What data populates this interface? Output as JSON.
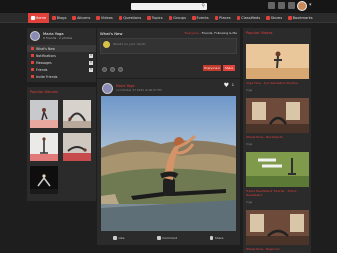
{
  "nav": {
    "items": [
      {
        "label": "Home",
        "active": true
      },
      {
        "label": "Blogs"
      },
      {
        "label": "Albums"
      },
      {
        "label": "Videos"
      },
      {
        "label": "Questions"
      },
      {
        "label": "Topics"
      },
      {
        "label": "Groups"
      },
      {
        "label": "Events"
      },
      {
        "label": "Places"
      },
      {
        "label": "Classifieds"
      },
      {
        "label": "Stores"
      },
      {
        "label": "Bookmarks"
      }
    ]
  },
  "search": {
    "placeholder": ""
  },
  "profile": {
    "name": "Maria Yoga",
    "stats": "6 friends · 2 photos",
    "menu": [
      {
        "label": "What's New",
        "active": true
      },
      {
        "label": "Notifications",
        "count": "0"
      },
      {
        "label": "Messages",
        "count": "0"
      },
      {
        "label": "Friends",
        "count": "0"
      },
      {
        "label": "Invite Friends"
      }
    ]
  },
  "albums": {
    "title": "Popular Albums"
  },
  "whatsnew": {
    "title": "What's New",
    "tabs_selected": "Everyone",
    "tabs_rest": " · Friends, Following & Me",
    "placeholder": "What's on your mind?",
    "share_label": "Everyone ▾",
    "post_label": "Share"
  },
  "post": {
    "author": "Maria Yoga",
    "date": "on October 27 2022 at 06:07 PM",
    "like_count": "1",
    "actions": {
      "like": "Like",
      "comment": "Comment",
      "share": "Share"
    }
  },
  "videos": {
    "title": "Popular Videos",
    "items": [
      {
        "caption": "Yoga Flow - Sun Salutation Routine",
        "meta": "Yoga"
      },
      {
        "caption": "Wheel Pose - Backbends",
        "meta": "Yoga"
      },
      {
        "caption": "Tripod Headstand Tutorial - Tripod Headstand",
        "meta": "Yoga"
      },
      {
        "caption": "Wheel Pose - Beginner",
        "meta": "Yoga"
      }
    ]
  },
  "colors": {
    "accent": "#e0413b",
    "panel": "#2b2b2b",
    "background": "#1e1e1e"
  }
}
